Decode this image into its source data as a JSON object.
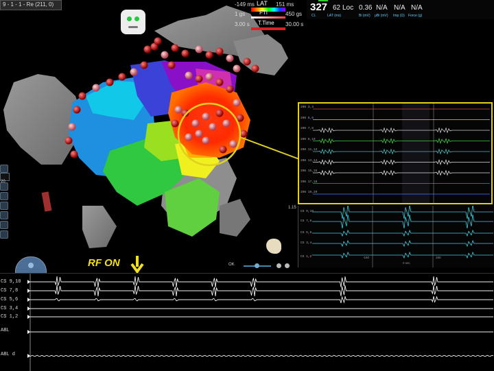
{
  "tab": {
    "label": "9 - 1 - 1 - Re (211, 0)"
  },
  "legend": {
    "lat_title": "LAT",
    "lat_min": "-149 ms",
    "lat_max": "151 ms",
    "fti_title": "FTI",
    "fti_max": "450 gs",
    "fti_min": "1 gs",
    "time_title": "T.Time",
    "time_min": "3.00 s",
    "time_max": "30.00 s"
  },
  "header": {
    "cl_value": "327",
    "cl_label": "CL",
    "lat_value": "62",
    "loc_label": "Loc",
    "lat_label": "LAT (ms)",
    "bi_value": "0.36",
    "bi_label": "Bi (mV)",
    "uni_value": "N/A",
    "uni_label": "μBi (mV)",
    "imp_value": "N/A",
    "imp_label": "Imp (Ω)",
    "force_value": "N/A",
    "force_label": "Force (g)"
  },
  "zoom_panel": {
    "channels": [
      "206 3,4",
      "206 5,6",
      "206 7,8",
      "206 9,10",
      "206 11,12",
      "206 13,14",
      "206 15,16",
      "206 17,18",
      "206 19,20"
    ]
  },
  "lower_panel": {
    "scale": "1.15",
    "channels": [
      "CS 9,10",
      "CS 7,8",
      "CS 5,6",
      "CS 3,4",
      "CS 1,2"
    ],
    "time_left": "-160",
    "time_center": "0 sec",
    "time_right": "160"
  },
  "view_controls": {
    "ok_label": "OK"
  },
  "tracing": {
    "channels": [
      "CS 9,10",
      "CS 7,8",
      "CS 5,6",
      "CS 3,4",
      "CS 1,2",
      "ABL",
      "ABL d"
    ]
  },
  "annotation": {
    "rf_on": "RF ON"
  },
  "sidebar": {
    "value": "20"
  },
  "colors": {
    "accent": "#f0e020",
    "zoom_border": "#e0d020"
  }
}
